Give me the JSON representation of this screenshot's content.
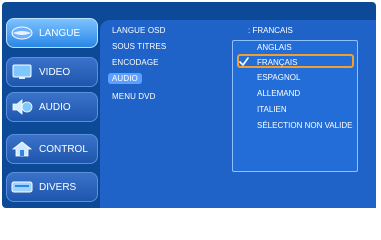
{
  "sidebar": {
    "items": [
      {
        "label": "LANGUE",
        "icon": "lips-icon"
      },
      {
        "label": "VIDEO",
        "icon": "monitor-icon"
      },
      {
        "label": "AUDIO",
        "icon": "speaker-icon"
      },
      {
        "label": "CONTROL",
        "icon": "house-icon"
      },
      {
        "label": "DIVERS",
        "icon": "panel-icon"
      }
    ],
    "active": "LANGUE"
  },
  "settings": {
    "items": [
      "LANGUE OSD",
      "SOUS TITRES",
      "ENCODAGE",
      "AUDIO",
      "MENU DVD"
    ],
    "selected": "AUDIO",
    "current_value": ": FRANCAIS"
  },
  "dropdown": {
    "options": [
      "ANGLAIS",
      "FRANÇAIS",
      "ESPAGNOL",
      "ALLEMAND",
      "ITALIEN",
      "SÉLECTION NON VALIDE"
    ],
    "selected": "FRANÇAIS"
  },
  "colors": {
    "frame": "#0c4a98",
    "panel": "#1f63c8",
    "highlight": "#f0a030"
  }
}
